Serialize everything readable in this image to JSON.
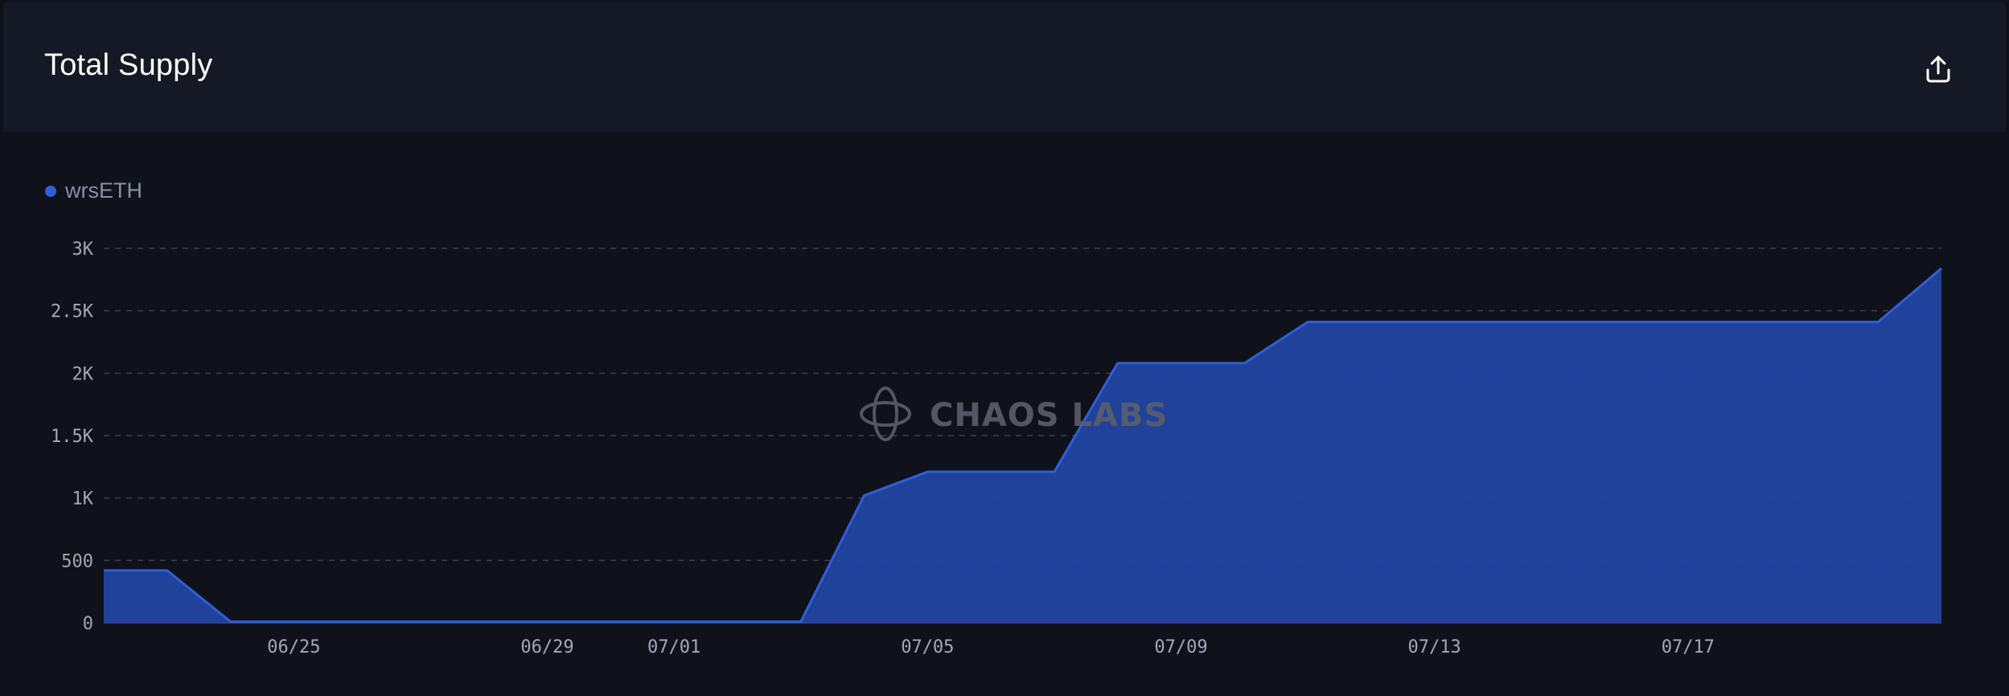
{
  "card": {
    "title": "Total Supply",
    "export_icon": "share-export-icon"
  },
  "legend": {
    "label": "wrsETH",
    "color": "#2f5fd7"
  },
  "watermark": {
    "text": "CHAOS LABS",
    "icon": "chaos-labs-logo-icon"
  },
  "chart_data": {
    "type": "area",
    "title": "Total Supply",
    "xlabel": "",
    "ylabel": "",
    "ylim": [
      0,
      3000
    ],
    "grid": true,
    "legend_position": "top-left",
    "y_ticks": [
      0,
      500,
      1000,
      1500,
      2000,
      2500,
      3000
    ],
    "y_tick_labels": [
      "0",
      "500",
      "1K",
      "1.5K",
      "2K",
      "2.5K",
      "3K"
    ],
    "x_tick_labels": [
      "06/25",
      "06/29",
      "07/01",
      "07/05",
      "07/09",
      "07/13",
      "07/17"
    ],
    "x_tick_dates": [
      "2024-06-25",
      "2024-06-29",
      "2024-07-01",
      "2024-07-05",
      "2024-07-09",
      "2024-07-13",
      "2024-07-17"
    ],
    "x_range": [
      "2024-06-22",
      "2024-07-21"
    ],
    "series": [
      {
        "name": "wrsETH",
        "color": "#2f5fd7",
        "points": [
          {
            "date": "2024-06-22",
            "value": 420
          },
          {
            "date": "2024-06-23",
            "value": 420
          },
          {
            "date": "2024-06-24",
            "value": 10
          },
          {
            "date": "2024-06-25",
            "value": 10
          },
          {
            "date": "2024-06-26",
            "value": 10
          },
          {
            "date": "2024-06-27",
            "value": 10
          },
          {
            "date": "2024-06-28",
            "value": 10
          },
          {
            "date": "2024-06-29",
            "value": 10
          },
          {
            "date": "2024-06-30",
            "value": 10
          },
          {
            "date": "2024-07-01",
            "value": 10
          },
          {
            "date": "2024-07-02",
            "value": 10
          },
          {
            "date": "2024-07-03",
            "value": 10
          },
          {
            "date": "2024-07-04",
            "value": 1020
          },
          {
            "date": "2024-07-05",
            "value": 1210
          },
          {
            "date": "2024-07-06",
            "value": 1210
          },
          {
            "date": "2024-07-07",
            "value": 1210
          },
          {
            "date": "2024-07-08",
            "value": 2080
          },
          {
            "date": "2024-07-09",
            "value": 2080
          },
          {
            "date": "2024-07-10",
            "value": 2080
          },
          {
            "date": "2024-07-11",
            "value": 2410
          },
          {
            "date": "2024-07-12",
            "value": 2410
          },
          {
            "date": "2024-07-13",
            "value": 2410
          },
          {
            "date": "2024-07-14",
            "value": 2410
          },
          {
            "date": "2024-07-15",
            "value": 2410
          },
          {
            "date": "2024-07-16",
            "value": 2410
          },
          {
            "date": "2024-07-17",
            "value": 2410
          },
          {
            "date": "2024-07-18",
            "value": 2410
          },
          {
            "date": "2024-07-19",
            "value": 2410
          },
          {
            "date": "2024-07-20",
            "value": 2410
          },
          {
            "date": "2024-07-21",
            "value": 2840
          }
        ]
      }
    ]
  }
}
